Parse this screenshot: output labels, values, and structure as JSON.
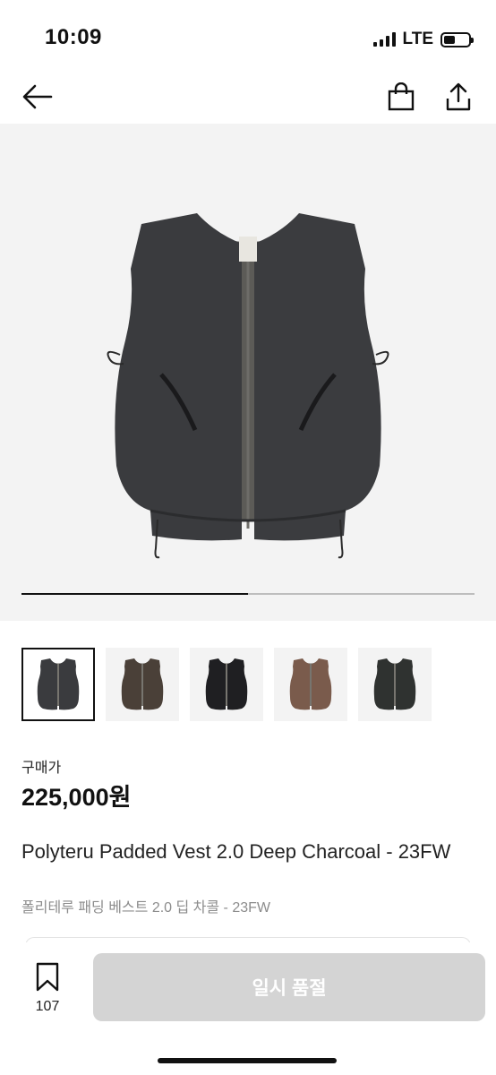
{
  "status_bar": {
    "time": "10:09",
    "network": "LTE",
    "battery_level": 0.45
  },
  "nav": {
    "back_icon": "arrow-left-icon",
    "bag_icon": "shopping-bag-icon",
    "share_icon": "share-icon"
  },
  "gallery": {
    "progress": 0.5,
    "thumbnails": [
      {
        "color": "#3a3b3e",
        "selected": true
      },
      {
        "color": "#4a4038",
        "selected": false
      },
      {
        "color": "#1f1f22",
        "selected": false
      },
      {
        "color": "#7a5b4c",
        "selected": false
      },
      {
        "color": "#2f3230",
        "selected": false
      }
    ]
  },
  "product": {
    "price_label": "구매가",
    "price": "225,000원",
    "title_en": "Polyteru Padded Vest 2.0 Deep Charcoal - 23FW",
    "title_ko": "폴리테루 패딩 베스트 2.0 딥 차콜 - 23FW"
  },
  "bottom_bar": {
    "bookmark_count": "107",
    "action_label": "일시 품절"
  },
  "colors": {
    "accent": "#111111",
    "disabled_button": "#d4d4d4",
    "image_bg": "#f3f3f3"
  }
}
